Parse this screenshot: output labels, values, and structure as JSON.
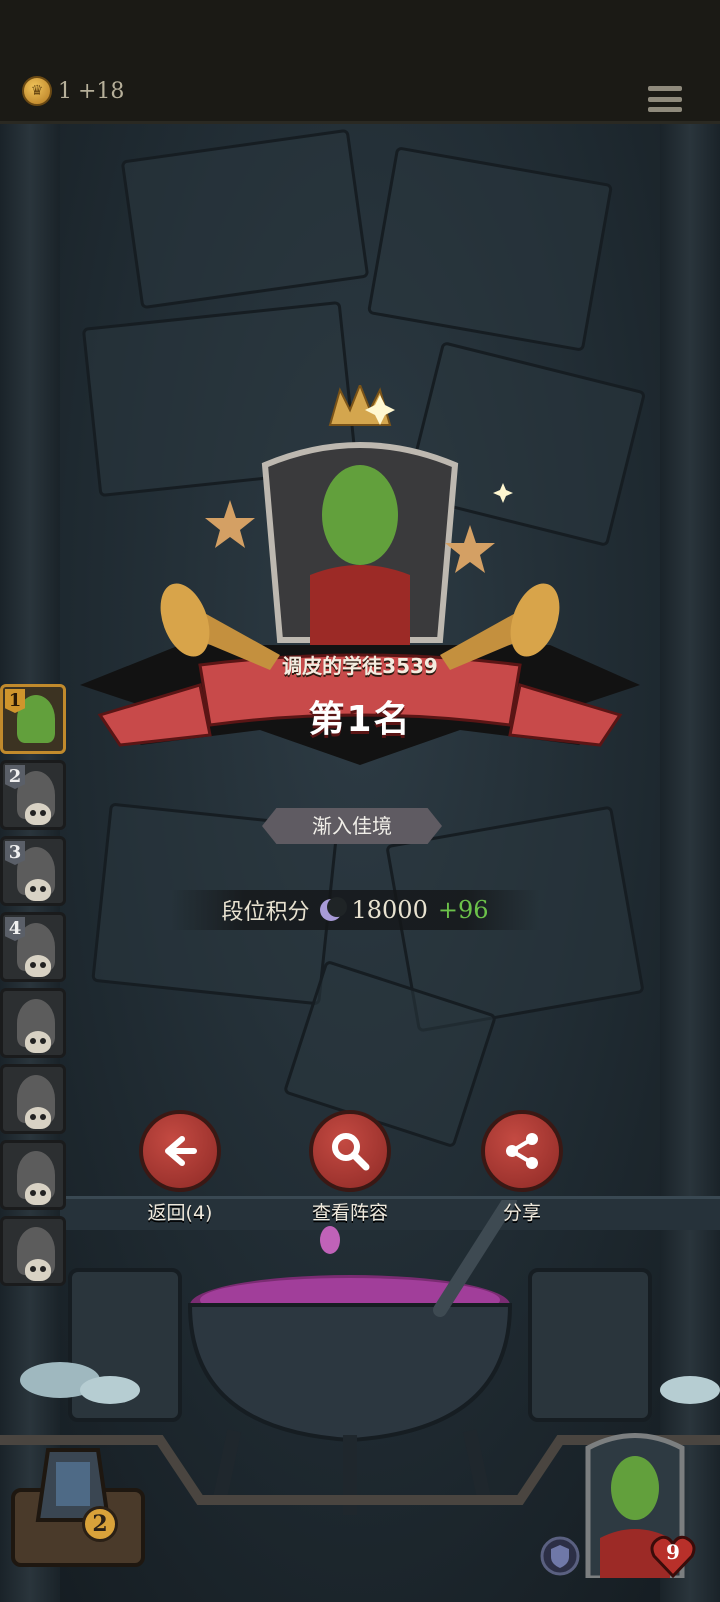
{
  "topbar": {
    "coin_amount": "1",
    "coin_delta": "+18",
    "coin_icon": "crown-coin-icon",
    "menu_icon": "hamburger-menu-icon"
  },
  "result": {
    "player_name": "调皮的学徒3539",
    "rank_title": "第1名",
    "tier": "渐入佳境",
    "score_label": "段位积分",
    "score_value": "18000",
    "score_delta": "+96"
  },
  "rank_list": [
    {
      "rank": "1",
      "status": "alive"
    },
    {
      "rank": "2",
      "status": "eliminated"
    },
    {
      "rank": "3",
      "status": "eliminated"
    },
    {
      "rank": "4",
      "status": "eliminated"
    },
    {
      "rank": "",
      "status": "eliminated"
    },
    {
      "rank": "",
      "status": "eliminated"
    },
    {
      "rank": "",
      "status": "eliminated"
    },
    {
      "rank": "",
      "status": "eliminated"
    }
  ],
  "actions": {
    "back_label": "返回(4)",
    "view_lineup_label": "查看阵容",
    "share_label": "分享"
  },
  "bottom": {
    "deck_count": "2",
    "hp": "9"
  },
  "colors": {
    "button_red": "#b23a34",
    "gold": "#d0952c",
    "score_green": "#6cc24a",
    "banner_red": "#c84a4a"
  }
}
